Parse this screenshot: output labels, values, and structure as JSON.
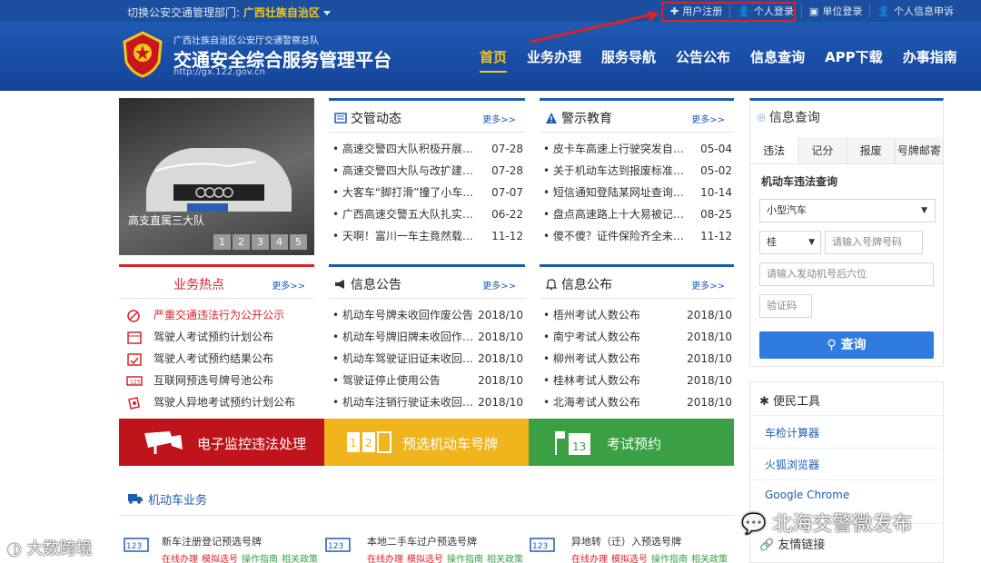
{
  "topbar": {
    "dept_prefix": "切换公安交通管理部门:",
    "dept_value": "广西壮族自治区",
    "links": [
      "用户注册",
      "个人登录",
      "单位登录",
      "个人信息申诉"
    ]
  },
  "header": {
    "org": "广西壮族自治区公安厅交通警察总队",
    "title": "交通安全综合服务管理平台",
    "url": "http://gx.122.gov.cn",
    "nav": [
      "首页",
      "业务办理",
      "服务导航",
      "公告公布",
      "信息查询",
      "APP下载",
      "办事指南"
    ]
  },
  "slide": {
    "caption": "高支直属三大队",
    "pages": [
      "1",
      "2",
      "3",
      "4",
      "5"
    ]
  },
  "news": {
    "title": "交管动态",
    "more": "更多>>",
    "items": [
      {
        "text": "高速交警四大队积极开展交...",
        "date": "07-28"
      },
      {
        "text": "高速交警四大队与改扩建单...",
        "date": "07-28"
      },
      {
        "text": "大客车“脚打滑”撞了小车...",
        "date": "07-07"
      },
      {
        "text": "广西高速交警五大队扎实开...",
        "date": "06-22"
      },
      {
        "text": "天啊！富川一车主竟然载着...",
        "date": "11-12"
      }
    ]
  },
  "warning": {
    "title": "警示教育",
    "more": "更多>>",
    "items": [
      {
        "text": "皮卡车高速上行驶突发自燃 ...",
        "date": "05-04"
      },
      {
        "text": "关于机动车达到报废标准携...",
        "date": "05-02"
      },
      {
        "text": "短信通知登陆某网址查询违...",
        "date": "10-14"
      },
      {
        "text": "盘点高速路上十大易被记分...",
        "date": "08-25"
      },
      {
        "text": "傻不傻？证件保险齐全未遵...",
        "date": "11-12"
      }
    ]
  },
  "hot": {
    "title": "业务热点",
    "more": "更多>>",
    "items": [
      {
        "text": "严重交通违法行为公开公示",
        "red": true
      },
      {
        "text": "驾驶人考试预约计划公布",
        "red": false
      },
      {
        "text": "驾驶人考试预约结果公布",
        "red": false
      },
      {
        "text": "互联网预选号牌号池公布",
        "red": false
      },
      {
        "text": "驾驶人异地考试预约计划公布",
        "red": false
      }
    ]
  },
  "info_notice": {
    "title": "信息公告",
    "more": "更多>>",
    "items": [
      {
        "text": "机动车号牌未收回作废公告",
        "date": "2018/10"
      },
      {
        "text": "机动车号牌旧牌未收回作废...",
        "date": "2018/10"
      },
      {
        "text": "机动车驾驶证旧证未收回作...",
        "date": "2018/10"
      },
      {
        "text": "驾驶证停止使用公告",
        "date": "2018/10"
      },
      {
        "text": "机动车注销行驶证未收回作...",
        "date": "2018/10"
      }
    ]
  },
  "info_publish": {
    "title": "信息公布",
    "more": "更多>>",
    "items": [
      {
        "text": "梧州考试人数公布",
        "date": "2018/10"
      },
      {
        "text": "南宁考试人数公布",
        "date": "2018/10"
      },
      {
        "text": "柳州考试人数公布",
        "date": "2018/10"
      },
      {
        "text": "桂林考试人数公布",
        "date": "2018/10"
      },
      {
        "text": "北海考试人数公布",
        "date": "2018/10"
      }
    ]
  },
  "banners": [
    {
      "label": "电子监控违法处理",
      "color": "#c0141c"
    },
    {
      "label": "预选机动车号牌",
      "color": "#f0b41c"
    },
    {
      "label": "考试预约",
      "color": "#3aa043"
    }
  ],
  "motor": {
    "title": "机动车业务",
    "items": [
      {
        "title": "新车注册登记预选号牌"
      },
      {
        "title": "本地二手车过户预选号牌"
      },
      {
        "title": "异地转（迁）入预选号牌"
      }
    ],
    "links": [
      "在线办理",
      "模拟选号",
      "操作指南",
      "相关政策"
    ]
  },
  "query": {
    "title": "信息查询",
    "tabs": [
      "违法",
      "记分",
      "报废",
      "号牌邮寄"
    ],
    "subtitle": "机动车违法查询",
    "vehicle_type": "小型汽车",
    "plate_prefix": "桂",
    "plate_placeholder": "请输入号牌号码",
    "engine_placeholder": "请输入发动机号后六位",
    "captcha_placeholder": "验证码",
    "button": "查询"
  },
  "tools": {
    "title": "便民工具",
    "links": [
      "车检计算器",
      "火狐浏览器",
      "Google Chrome"
    ],
    "friend": "友情链接"
  },
  "watermarks": [
    "北海交警微发布",
    "大数跨境"
  ],
  "colors": {
    "brand_blue": "#1e5cb3",
    "red": "#d8232a",
    "yellow": "#f5c518"
  }
}
